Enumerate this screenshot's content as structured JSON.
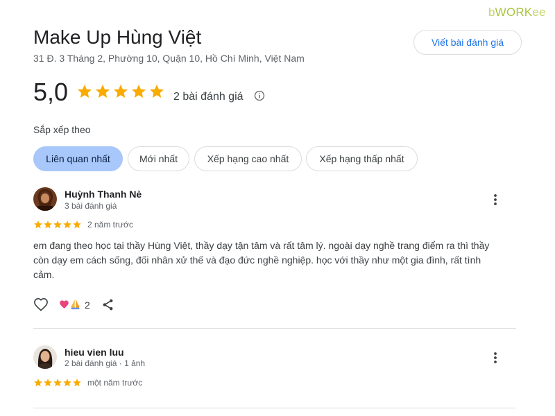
{
  "watermark": {
    "pre": "b",
    "mid": "WORK",
    "post": "ee"
  },
  "place": {
    "name": "Make Up Hùng Việt",
    "address": "31 Đ. 3 Tháng 2, Phường 10, Quận 10, Hồ Chí Minh, Việt Nam"
  },
  "actions": {
    "write_review": "Viết bài đánh giá"
  },
  "summary": {
    "rating": "5,0",
    "stars": 5,
    "review_count": "2 bài đánh giá",
    "info_icon": "info-icon"
  },
  "sort": {
    "label": "Sắp xếp theo",
    "options": [
      {
        "label": "Liên quan nhất",
        "selected": true
      },
      {
        "label": "Mới nhất",
        "selected": false
      },
      {
        "label": "Xếp hạng cao nhất",
        "selected": false
      },
      {
        "label": "Xếp hạng thấp nhất",
        "selected": false
      }
    ]
  },
  "reviews": [
    {
      "author": "Huỳnh Thanh Nè",
      "meta": "3 bài đánh giá",
      "stars": 5,
      "time": "2 năm trước",
      "text": "em đang theo học tại thầy Hùng Việt, thầy dạy tận tâm và rất tâm lý. ngoài dạy nghề trang điểm ra thì thầy còn dạy em cách sống, đối nhân xử thế và đạo đức nghề nghiệp. học với thầy như một gia đình, rất tình cảm.",
      "reactions": {
        "count": "2",
        "icons": [
          "heart-reaction-icon",
          "pray-reaction-icon"
        ]
      },
      "action_icons": [
        "like-heart-icon",
        "share-icon",
        "more-vert-icon"
      ]
    },
    {
      "author": "hieu vien luu",
      "meta": "2 bài đánh giá · 1 ảnh",
      "stars": 5,
      "time": "một năm trước",
      "action_icons": [
        "more-vert-icon"
      ]
    }
  ],
  "colors": {
    "star": "#f9ab00",
    "accent_link": "#1a73e8",
    "active_chip": "#a8c7fa",
    "divider": "#dadce0",
    "watermark": "#c4d66a"
  }
}
